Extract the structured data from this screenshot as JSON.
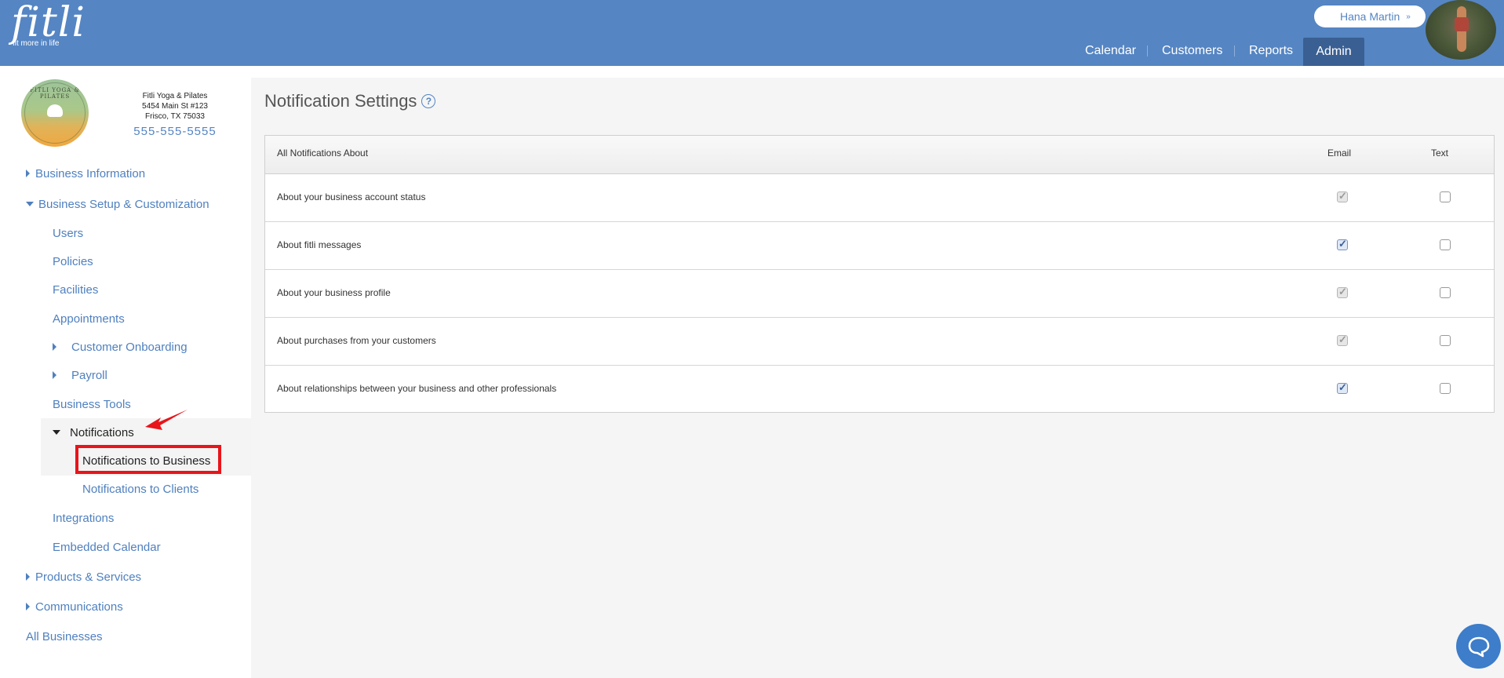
{
  "header": {
    "logo_text": "fitli",
    "logo_tagline": "fit more in life",
    "user_name": "Hana Martin",
    "user_chevron": "»",
    "nav": [
      {
        "label": "Calendar"
      },
      {
        "label": "Customers"
      },
      {
        "label": "Reports"
      },
      {
        "label": "Admin",
        "active": true
      }
    ]
  },
  "business": {
    "logo_text": "FITLI YOGA & PILATES",
    "name": "Fitli Yoga & Pilates",
    "address1": "5454 Main St #123",
    "address2": "Frisco, TX 75033",
    "phone": "555-555-5555"
  },
  "sidebar": {
    "business_information": "Business Information",
    "business_setup": "Business Setup & Customization",
    "users": "Users",
    "policies": "Policies",
    "facilities": "Facilities",
    "appointments": "Appointments",
    "customer_onboarding": "Customer Onboarding",
    "payroll": "Payroll",
    "business_tools": "Business Tools",
    "notifications": "Notifications",
    "notifications_to_business": "Notifications to Business",
    "notifications_to_clients": "Notifications to Clients",
    "integrations": "Integrations",
    "embedded_calendar": "Embedded Calendar",
    "products_services": "Products & Services",
    "communications": "Communications",
    "all_businesses": "All Businesses"
  },
  "main": {
    "title": "Notification Settings",
    "help_icon": "?",
    "table": {
      "headers": {
        "about": "All Notifications About",
        "email": "Email",
        "text": "Text"
      },
      "rows": [
        {
          "label": "About your business account status",
          "email": true,
          "email_disabled": true,
          "text": false
        },
        {
          "label": "About fitli messages",
          "email": true,
          "email_disabled": false,
          "text": false
        },
        {
          "label": "About your business profile",
          "email": true,
          "email_disabled": true,
          "text": false
        },
        {
          "label": "About purchases from your customers",
          "email": true,
          "email_disabled": true,
          "text": false
        },
        {
          "label": "About relationships between your business and other professionals",
          "email": true,
          "email_disabled": false,
          "text": false
        }
      ]
    }
  },
  "colors": {
    "header_bg": "#5585c3",
    "admin_tab_bg": "#3a5f92",
    "link": "#4f80bf",
    "highlight_box": "#e8141a",
    "chat_bg": "#3d7dc9"
  },
  "icons": [
    "help-icon",
    "chevron-down-icon",
    "chat-icon",
    "arrow-annotation-icon"
  ]
}
